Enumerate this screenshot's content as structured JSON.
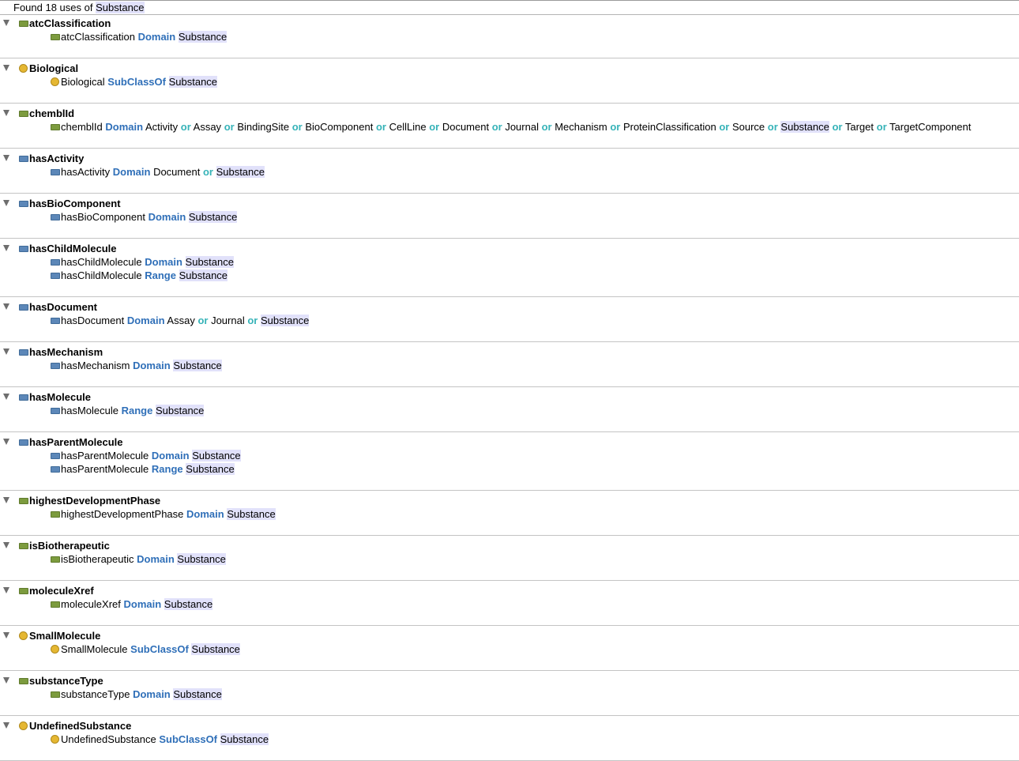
{
  "header": {
    "prefix": "Found 18 uses of",
    "entity": "Substance"
  },
  "groups": [
    {
      "title": "atcClassification",
      "icon": "data-property-icon",
      "rows": [
        {
          "icon": "data-property-icon",
          "tokens": [
            {
              "t": "atcClassification",
              "k": "plain"
            },
            {
              "t": "Domain",
              "k": "kw"
            },
            {
              "t": "Substance",
              "k": "hl"
            }
          ]
        }
      ]
    },
    {
      "title": "Biological",
      "icon": "class-icon",
      "rows": [
        {
          "icon": "class-icon",
          "tokens": [
            {
              "t": "Biological",
              "k": "plain"
            },
            {
              "t": "SubClassOf",
              "k": "kw"
            },
            {
              "t": "Substance",
              "k": "hl"
            }
          ]
        }
      ]
    },
    {
      "title": "chemblId",
      "icon": "data-property-icon",
      "rows": [
        {
          "icon": "data-property-icon",
          "tokens": [
            {
              "t": "chemblId",
              "k": "plain"
            },
            {
              "t": "Domain",
              "k": "kw"
            },
            {
              "t": "Activity",
              "k": "plain"
            },
            {
              "t": "or",
              "k": "or"
            },
            {
              "t": "Assay",
              "k": "plain"
            },
            {
              "t": "or",
              "k": "or"
            },
            {
              "t": "BindingSite",
              "k": "plain"
            },
            {
              "t": "or",
              "k": "or"
            },
            {
              "t": "BioComponent",
              "k": "plain"
            },
            {
              "t": "or",
              "k": "or"
            },
            {
              "t": "CellLine",
              "k": "plain"
            },
            {
              "t": "or",
              "k": "or"
            },
            {
              "t": "Document",
              "k": "plain"
            },
            {
              "t": "or",
              "k": "or"
            },
            {
              "t": "Journal",
              "k": "plain"
            },
            {
              "t": "or",
              "k": "or"
            },
            {
              "t": "Mechanism",
              "k": "plain"
            },
            {
              "t": "or",
              "k": "or"
            },
            {
              "t": "ProteinClassification",
              "k": "plain"
            },
            {
              "t": "or",
              "k": "or"
            },
            {
              "t": "Source",
              "k": "plain"
            },
            {
              "t": "or",
              "k": "or"
            },
            {
              "t": "Substance",
              "k": "hl"
            },
            {
              "t": "or",
              "k": "or"
            },
            {
              "t": "Target",
              "k": "plain"
            },
            {
              "t": "or",
              "k": "or"
            },
            {
              "t": "TargetComponent",
              "k": "plain"
            }
          ]
        }
      ]
    },
    {
      "title": "hasActivity",
      "icon": "object-property-icon",
      "rows": [
        {
          "icon": "object-property-icon",
          "tokens": [
            {
              "t": "hasActivity",
              "k": "plain"
            },
            {
              "t": "Domain",
              "k": "kw"
            },
            {
              "t": "Document",
              "k": "plain"
            },
            {
              "t": "or",
              "k": "or"
            },
            {
              "t": "Substance",
              "k": "hl"
            }
          ]
        }
      ]
    },
    {
      "title": "hasBioComponent",
      "icon": "object-property-icon",
      "rows": [
        {
          "icon": "object-property-icon",
          "tokens": [
            {
              "t": "hasBioComponent",
              "k": "plain"
            },
            {
              "t": "Domain",
              "k": "kw"
            },
            {
              "t": "Substance",
              "k": "hl"
            }
          ]
        }
      ]
    },
    {
      "title": "hasChildMolecule",
      "icon": "object-property-icon",
      "rows": [
        {
          "icon": "object-property-icon",
          "tokens": [
            {
              "t": "hasChildMolecule",
              "k": "plain"
            },
            {
              "t": "Domain",
              "k": "kw"
            },
            {
              "t": "Substance",
              "k": "hl"
            }
          ]
        },
        {
          "icon": "object-property-icon",
          "tokens": [
            {
              "t": "hasChildMolecule",
              "k": "plain"
            },
            {
              "t": "Range",
              "k": "kw"
            },
            {
              "t": "Substance",
              "k": "hl"
            }
          ]
        }
      ]
    },
    {
      "title": "hasDocument",
      "icon": "object-property-icon",
      "rows": [
        {
          "icon": "object-property-icon",
          "tokens": [
            {
              "t": "hasDocument",
              "k": "plain"
            },
            {
              "t": "Domain",
              "k": "kw"
            },
            {
              "t": "Assay",
              "k": "plain"
            },
            {
              "t": "or",
              "k": "or"
            },
            {
              "t": "Journal",
              "k": "plain"
            },
            {
              "t": "or",
              "k": "or"
            },
            {
              "t": "Substance",
              "k": "hl"
            }
          ]
        }
      ]
    },
    {
      "title": "hasMechanism",
      "icon": "object-property-icon",
      "rows": [
        {
          "icon": "object-property-icon",
          "tokens": [
            {
              "t": "hasMechanism",
              "k": "plain"
            },
            {
              "t": "Domain",
              "k": "kw"
            },
            {
              "t": "Substance",
              "k": "hl"
            }
          ]
        }
      ]
    },
    {
      "title": "hasMolecule",
      "icon": "object-property-icon",
      "rows": [
        {
          "icon": "object-property-icon",
          "tokens": [
            {
              "t": "hasMolecule",
              "k": "plain"
            },
            {
              "t": "Range",
              "k": "kw"
            },
            {
              "t": "Substance",
              "k": "hl"
            }
          ]
        }
      ]
    },
    {
      "title": "hasParentMolecule",
      "icon": "object-property-icon",
      "rows": [
        {
          "icon": "object-property-icon",
          "tokens": [
            {
              "t": "hasParentMolecule",
              "k": "plain"
            },
            {
              "t": "Domain",
              "k": "kw"
            },
            {
              "t": "Substance",
              "k": "hl"
            }
          ]
        },
        {
          "icon": "object-property-icon",
          "tokens": [
            {
              "t": "hasParentMolecule",
              "k": "plain"
            },
            {
              "t": "Range",
              "k": "kw"
            },
            {
              "t": "Substance",
              "k": "hl"
            }
          ]
        }
      ]
    },
    {
      "title": "highestDevelopmentPhase",
      "icon": "data-property-icon",
      "rows": [
        {
          "icon": "data-property-icon",
          "tokens": [
            {
              "t": "highestDevelopmentPhase",
              "k": "plain"
            },
            {
              "t": "Domain",
              "k": "kw"
            },
            {
              "t": "Substance",
              "k": "hl"
            }
          ]
        }
      ]
    },
    {
      "title": "isBiotherapeutic",
      "icon": "data-property-icon",
      "rows": [
        {
          "icon": "data-property-icon",
          "tokens": [
            {
              "t": "isBiotherapeutic",
              "k": "plain"
            },
            {
              "t": "Domain",
              "k": "kw"
            },
            {
              "t": "Substance",
              "k": "hl"
            }
          ]
        }
      ]
    },
    {
      "title": "moleculeXref",
      "icon": "data-property-icon",
      "rows": [
        {
          "icon": "data-property-icon",
          "tokens": [
            {
              "t": "moleculeXref",
              "k": "plain"
            },
            {
              "t": "Domain",
              "k": "kw"
            },
            {
              "t": "Substance",
              "k": "hl"
            }
          ]
        }
      ]
    },
    {
      "title": "SmallMolecule",
      "icon": "class-icon",
      "rows": [
        {
          "icon": "class-icon",
          "tokens": [
            {
              "t": "SmallMolecule",
              "k": "plain"
            },
            {
              "t": "SubClassOf",
              "k": "kw"
            },
            {
              "t": "Substance",
              "k": "hl"
            }
          ]
        }
      ]
    },
    {
      "title": "substanceType",
      "icon": "data-property-icon",
      "rows": [
        {
          "icon": "data-property-icon",
          "tokens": [
            {
              "t": "substanceType",
              "k": "plain"
            },
            {
              "t": "Domain",
              "k": "kw"
            },
            {
              "t": "Substance",
              "k": "hl"
            }
          ]
        }
      ]
    },
    {
      "title": "UndefinedSubstance",
      "icon": "class-icon",
      "rows": [
        {
          "icon": "class-icon",
          "tokens": [
            {
              "t": "UndefinedSubstance",
              "k": "plain"
            },
            {
              "t": "SubClassOf",
              "k": "kw"
            },
            {
              "t": "Substance",
              "k": "hl"
            }
          ]
        }
      ]
    }
  ],
  "colors": {
    "keyword": "#2f6fb8",
    "or_keyword": "#36b3b8",
    "highlight": "#e1e1fa",
    "data_property": "#7c9b3e",
    "object_property": "#5c87b8",
    "class": "#e5b732"
  }
}
